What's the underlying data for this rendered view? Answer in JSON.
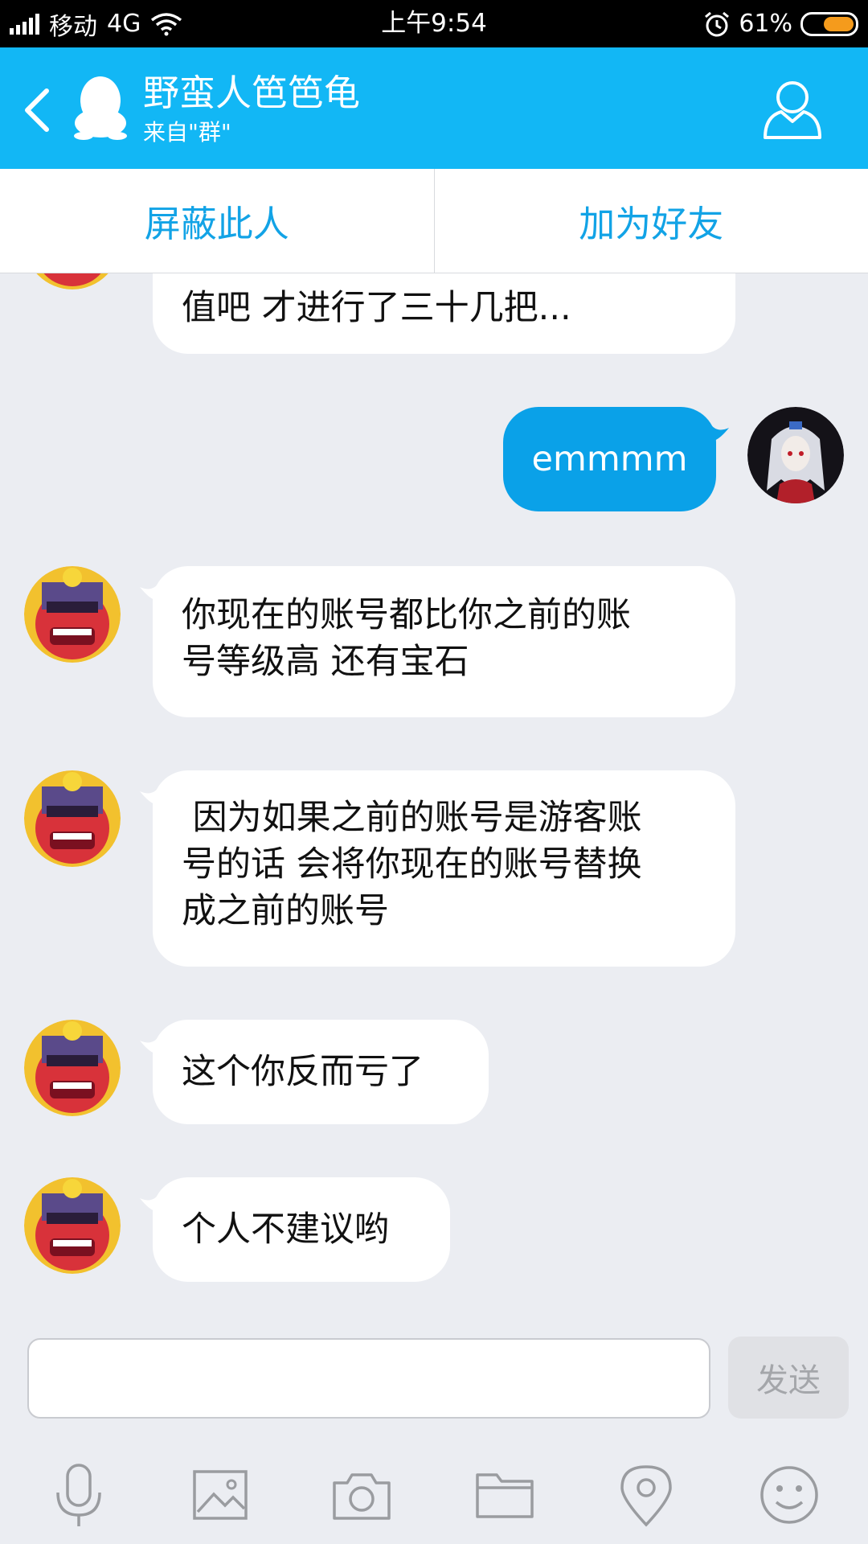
{
  "status_bar": {
    "carrier": "移动",
    "network": "4G",
    "time": "上午9:54",
    "battery_text": "61%",
    "battery_level": 0.61
  },
  "header": {
    "title": "野蛮人笆笆龟",
    "subtitle": "来自\"群\""
  },
  "actions": {
    "block_label": "屏蔽此人",
    "add_friend_label": "加为好友"
  },
  "messages": [
    {
      "direction": "received",
      "text": "值吧 才进行了三十几把..."
    },
    {
      "direction": "sent",
      "text": "emmmm"
    },
    {
      "direction": "received",
      "lines": [
        "你现在的账号都比你之前的账",
        "号等级高 还有宝石"
      ]
    },
    {
      "direction": "received",
      "lines": [
        " 因为如果之前的账号是游客账",
        "号的话 会将你现在的账号替换",
        "成之前的账号"
      ]
    },
    {
      "direction": "received",
      "text": "这个你反而亏了"
    },
    {
      "direction": "received",
      "text": "个人不建议哟"
    }
  ],
  "input": {
    "value": "",
    "send_label": "发送"
  },
  "toolbar": {
    "icons": [
      "microphone-icon",
      "image-icon",
      "camera-icon",
      "folder-icon",
      "location-icon",
      "emoji-icon"
    ]
  },
  "colors": {
    "header": "#12b7f5",
    "sent_bubble": "#0aa1e8",
    "action_text": "#12a3e6",
    "background": "#ebedf2",
    "battery": "#f59b1c"
  }
}
